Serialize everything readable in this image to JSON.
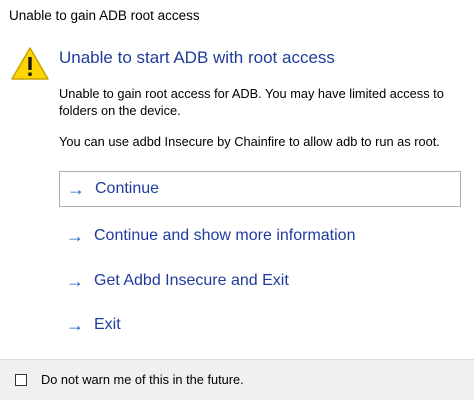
{
  "window": {
    "title": "Unable to gain ADB root access"
  },
  "dialog": {
    "icon": "warning-icon",
    "main_instruction": "Unable to start ADB with root access",
    "content_line1": "Unable to gain root access for ADB. You may have limited access to",
    "content_line2": "folders on the device.",
    "content_para2": "You can use adbd Insecure by Chainfire to allow adb to run as root."
  },
  "command_links": [
    {
      "label": "Continue",
      "focused": true
    },
    {
      "label": "Continue and show more information",
      "focused": false
    },
    {
      "label": "Get Adbd Insecure and Exit",
      "focused": false
    },
    {
      "label": "Exit",
      "focused": false
    }
  ],
  "footer": {
    "checkbox_label": "Do not warn me of this in the future.",
    "checked": false
  },
  "colors": {
    "instruction": "#1f3c9c",
    "link": "#1f3c9c",
    "arrow": "#1f5fbf",
    "warning_fill": "#ffd400",
    "footer_bg": "#f0f0f0"
  }
}
